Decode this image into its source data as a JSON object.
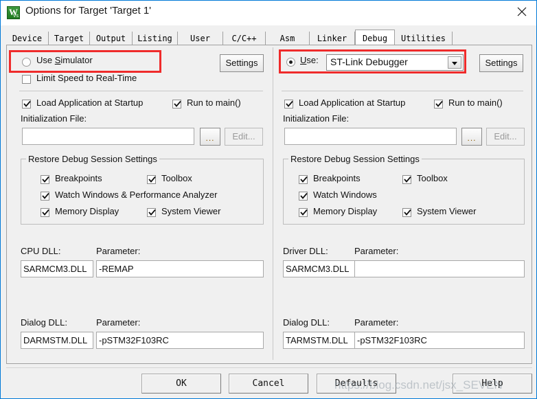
{
  "window": {
    "title": "Options for Target 'Target 1'",
    "icon": "keil-uvision-icon",
    "icon_glyph": "W",
    "icon_glyph_sub": "Vs",
    "close_label": "close-icon"
  },
  "tabs": [
    {
      "label": "Device",
      "selected": false
    },
    {
      "label": "Target",
      "selected": false
    },
    {
      "label": "Output",
      "selected": false
    },
    {
      "label": "Listing",
      "selected": false
    },
    {
      "label": "User",
      "selected": false
    },
    {
      "label": "C/C++",
      "selected": false
    },
    {
      "label": "Asm",
      "selected": false
    },
    {
      "label": "Linker",
      "selected": false
    },
    {
      "label": "Debug",
      "selected": true
    },
    {
      "label": "Utilities",
      "selected": false
    }
  ],
  "simulator_panel": {
    "use_simulator": {
      "label_pre": "Use ",
      "label_accel": "S",
      "label_post": "imulator",
      "checked": false
    },
    "limit_speed": {
      "label": "Limit Speed to Real-Time",
      "checked": false
    },
    "settings_button": "Settings",
    "load_application": {
      "label": "Load Application at Startup",
      "checked": true
    },
    "run_to_main": {
      "label": "Run to main()",
      "checked": true
    },
    "init_file_label": "Initialization File:",
    "init_file_value": "",
    "browse_button": "...",
    "edit_button": "Edit...",
    "restore_group": {
      "caption": "Restore Debug Session Settings",
      "items": [
        {
          "label": "Breakpoints",
          "checked": true
        },
        {
          "label": "Toolbox",
          "checked": true
        },
        {
          "label": "Watch Windows & Performance Analyzer",
          "checked": true
        },
        {
          "label": "Memory Display",
          "checked": true
        },
        {
          "label": "System Viewer",
          "checked": true
        }
      ]
    },
    "cpu_dll_label": "CPU DLL:",
    "cpu_dll_value": "SARMCM3.DLL",
    "cpu_param_label": "Parameter:",
    "cpu_param_value": "-REMAP",
    "dialog_dll_label": "Dialog DLL:",
    "dialog_dll_value": "DARMSTM.DLL",
    "dialog_param_label": "Parameter:",
    "dialog_param_value": "-pSTM32F103RC"
  },
  "debugger_panel": {
    "use_radio": {
      "label_pre": "",
      "label_accel": "U",
      "label_post": "se:",
      "checked": true
    },
    "debugger_selected": "ST-Link Debugger",
    "settings_button": "Settings",
    "load_application": {
      "label": "Load Application at Startup",
      "checked": true
    },
    "run_to_main": {
      "label": "Run to main()",
      "checked": true
    },
    "init_file_label": "Initialization File:",
    "init_file_value": "",
    "browse_button": "...",
    "edit_button": "Edit...",
    "restore_group": {
      "caption": "Restore Debug Session Settings",
      "items": [
        {
          "label": "Breakpoints",
          "checked": true
        },
        {
          "label": "Toolbox",
          "checked": true
        },
        {
          "label": "Watch Windows",
          "checked": true
        },
        {
          "label": "Memory Display",
          "checked": true
        },
        {
          "label": "System Viewer",
          "checked": true
        }
      ]
    },
    "driver_dll_label": "Driver DLL:",
    "driver_dll_value": "SARMCM3.DLL",
    "driver_param_label": "Parameter:",
    "driver_param_value": "",
    "dialog_dll_label": "Dialog DLL:",
    "dialog_dll_value": "TARMSTM.DLL",
    "dialog_param_label": "Parameter:",
    "dialog_param_value": "-pSTM32F103RC"
  },
  "footer": {
    "ok": "OK",
    "cancel": "Cancel",
    "defaults": "Defaults",
    "help": "Help"
  },
  "watermark": "https://blog.csdn.net/jsx_SEVEN",
  "annotations": {
    "accent_color": "#ef2b2b",
    "boxes": [
      {
        "name": "use-simulator-highlight"
      },
      {
        "name": "use-debugger-highlight"
      }
    ]
  }
}
